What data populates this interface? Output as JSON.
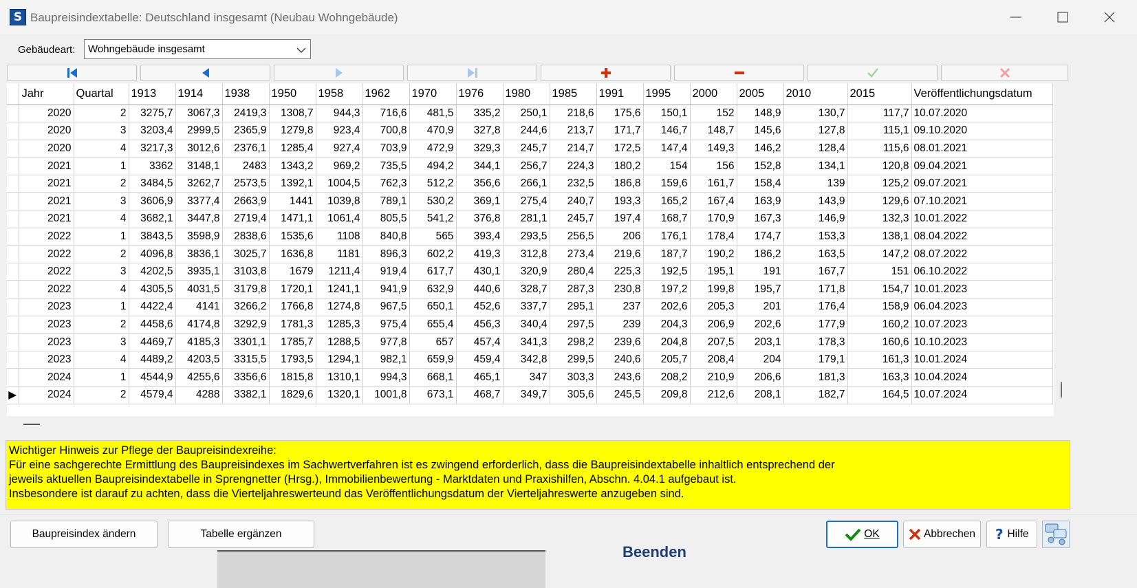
{
  "window": {
    "app_icon": "S",
    "title": "Baupreisindextabelle: Deutschland insgesamt (Neubau Wohngebäude)"
  },
  "filter": {
    "label": "Gebäudeart:",
    "selected": "Wohngebäude insgesamt"
  },
  "navigator": {
    "icons": [
      "first-record-icon",
      "prior-record-icon",
      "next-record-icon",
      "last-record-icon",
      "insert-record-icon",
      "delete-record-icon",
      "post-record-icon",
      "cancel-record-icon"
    ],
    "colors": {
      "active": "#1b6fc8",
      "disabled": "#a8c8e8",
      "insert": "#d03010",
      "delete": "#d03010",
      "post_disabled": "#9fd49f",
      "cancel_disabled": "#f0a0a0"
    }
  },
  "table": {
    "columns": [
      "Jahr",
      "Quartal",
      "1913",
      "1914",
      "1938",
      "1950",
      "1958",
      "1962",
      "1970",
      "1976",
      "1980",
      "1985",
      "1991",
      "1995",
      "2000",
      "2005",
      "2010",
      "2015",
      "Veröffentlichungsdatum"
    ],
    "rows": [
      [
        "2020",
        "2",
        "3275,7",
        "3067,3",
        "2419,3",
        "1308,7",
        "944,3",
        "716,6",
        "481,5",
        "335,2",
        "250,1",
        "218,6",
        "175,6",
        "150,1",
        "152",
        "148,9",
        "130,7",
        "117,7",
        "10.07.2020"
      ],
      [
        "2020",
        "3",
        "3203,4",
        "2999,5",
        "2365,9",
        "1279,8",
        "923,4",
        "700,8",
        "470,9",
        "327,8",
        "244,6",
        "213,7",
        "171,7",
        "146,7",
        "148,7",
        "145,6",
        "127,8",
        "115,1",
        "09.10.2020"
      ],
      [
        "2020",
        "4",
        "3217,3",
        "3012,6",
        "2376,1",
        "1285,4",
        "927,4",
        "703,9",
        "472,9",
        "329,3",
        "245,7",
        "214,7",
        "172,5",
        "147,4",
        "149,3",
        "146,2",
        "128,4",
        "115,6",
        "08.01.2021"
      ],
      [
        "2021",
        "1",
        "3362",
        "3148,1",
        "2483",
        "1343,2",
        "969,2",
        "735,5",
        "494,2",
        "344,1",
        "256,7",
        "224,3",
        "180,2",
        "154",
        "156",
        "152,8",
        "134,1",
        "120,8",
        "09.04.2021"
      ],
      [
        "2021",
        "2",
        "3484,5",
        "3262,7",
        "2573,5",
        "1392,1",
        "1004,5",
        "762,3",
        "512,2",
        "356,6",
        "266,1",
        "232,5",
        "186,8",
        "159,6",
        "161,7",
        "158,4",
        "139",
        "125,2",
        "09.07.2021"
      ],
      [
        "2021",
        "3",
        "3606,9",
        "3377,4",
        "2663,9",
        "1441",
        "1039,8",
        "789,1",
        "530,2",
        "369,1",
        "275,4",
        "240,7",
        "193,3",
        "165,2",
        "167,4",
        "163,9",
        "143,9",
        "129,6",
        "07.10.2021"
      ],
      [
        "2021",
        "4",
        "3682,1",
        "3447,8",
        "2719,4",
        "1471,1",
        "1061,4",
        "805,5",
        "541,2",
        "376,8",
        "281,1",
        "245,7",
        "197,4",
        "168,7",
        "170,9",
        "167,3",
        "146,9",
        "132,3",
        "10.01.2022"
      ],
      [
        "2022",
        "1",
        "3843,5",
        "3598,9",
        "2838,6",
        "1535,6",
        "1108",
        "840,8",
        "565",
        "393,4",
        "293,5",
        "256,5",
        "206",
        "176,1",
        "178,4",
        "174,7",
        "153,3",
        "138,1",
        "08.04.2022"
      ],
      [
        "2022",
        "2",
        "4096,8",
        "3836,1",
        "3025,7",
        "1636,8",
        "1181",
        "896,3",
        "602,2",
        "419,3",
        "312,8",
        "273,4",
        "219,6",
        "187,7",
        "190,2",
        "186,2",
        "163,5",
        "147,2",
        "08.07.2022"
      ],
      [
        "2022",
        "3",
        "4202,5",
        "3935,1",
        "3103,8",
        "1679",
        "1211,4",
        "919,4",
        "617,7",
        "430,1",
        "320,9",
        "280,4",
        "225,3",
        "192,5",
        "195,1",
        "191",
        "167,7",
        "151",
        "06.10.2022"
      ],
      [
        "2022",
        "4",
        "4305,5",
        "4031,5",
        "3179,8",
        "1720,1",
        "1241,1",
        "941,9",
        "632,9",
        "440,6",
        "328,7",
        "287,3",
        "230,8",
        "197,2",
        "199,8",
        "195,7",
        "171,8",
        "154,7",
        "10.01.2023"
      ],
      [
        "2023",
        "1",
        "4422,4",
        "4141",
        "3266,2",
        "1766,8",
        "1274,8",
        "967,5",
        "650,1",
        "452,6",
        "337,7",
        "295,1",
        "237",
        "202,6",
        "205,3",
        "201",
        "176,4",
        "158,9",
        "06.04.2023"
      ],
      [
        "2023",
        "2",
        "4458,6",
        "4174,8",
        "3292,9",
        "1781,3",
        "1285,3",
        "975,4",
        "655,4",
        "456,3",
        "340,4",
        "297,5",
        "239",
        "204,3",
        "206,9",
        "202,6",
        "177,9",
        "160,2",
        "10.07.2023"
      ],
      [
        "2023",
        "3",
        "4469,7",
        "4185,3",
        "3301,1",
        "1785,7",
        "1288,5",
        "977,8",
        "657",
        "457,4",
        "341,3",
        "298,2",
        "239,6",
        "204,8",
        "207,5",
        "203,1",
        "178,3",
        "160,6",
        "10.10.2023"
      ],
      [
        "2023",
        "4",
        "4489,2",
        "4203,5",
        "3315,5",
        "1793,5",
        "1294,1",
        "982,1",
        "659,9",
        "459,4",
        "342,8",
        "299,5",
        "240,6",
        "205,7",
        "208,4",
        "204",
        "179,1",
        "161,3",
        "10.01.2024"
      ],
      [
        "2024",
        "1",
        "4544,9",
        "4255,6",
        "3356,6",
        "1815,8",
        "1310,1",
        "994,3",
        "668,1",
        "465,1",
        "347",
        "303,3",
        "243,6",
        "208,2",
        "210,9",
        "206,6",
        "181,3",
        "163,3",
        "10.04.2024"
      ],
      [
        "2024",
        "2",
        "4579,4",
        "4288",
        "3382,1",
        "1829,6",
        "1320,1",
        "1001,8",
        "673,1",
        "468,7",
        "349,7",
        "305,6",
        "245,5",
        "209,8",
        "212,6",
        "208,1",
        "182,7",
        "164,5",
        "10.07.2024"
      ]
    ],
    "current_row_index": 16,
    "row_indicator": "▶"
  },
  "notice": {
    "lines": [
      "Wichtiger Hinweis zur Pflege der Baupreisindexreihe:",
      "Für eine sachgerechte Ermittlung des Baupreisindexes im Sachwertverfahren ist es zwingend erforderlich, dass die Baupreisindextabelle inhaltlich entsprechend der",
      "jeweils aktuellen Baupreisindextabelle in Sprengnetter (Hrsg.), Immobilienbewertung - Marktdaten und Praxishilfen, Abschn. 4.04.1 aufgebaut ist.",
      "Insbesondere ist darauf zu achten, dass die Vierteljahreswerteund das Veröffentlichungsdatum der Vierteljahreswerte  anzugeben sind."
    ],
    "background": "#ffff00"
  },
  "footer": {
    "change_index": "Baupreisindex ändern",
    "extend_table": "Tabelle ergänzen",
    "ok": "OK",
    "cancel": "Abbrechen",
    "help": "Hilfe",
    "background_peek_text": "Beenden"
  }
}
